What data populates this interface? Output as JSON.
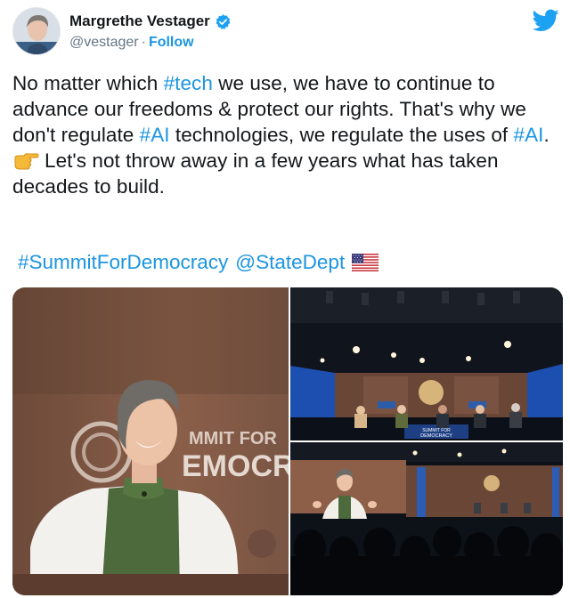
{
  "user": {
    "name": "Margrethe Vestager",
    "handle": "@vestager",
    "separator": "·",
    "follow_label": "Follow"
  },
  "icons": {
    "verified": "verified-badge-icon",
    "platform": "twitter-bird-icon",
    "hand": "backhand-index-pointing-right-icon",
    "flag": "us-flag-icon"
  },
  "colors": {
    "link": "#1b95e0",
    "verified": "#1da1f2",
    "text": "#14171a",
    "muted": "#657786"
  },
  "tweet": {
    "seg1": "No matter which ",
    "tag_tech": "#tech",
    "seg2": " we use, we have to continue to advance our freedoms & protect our rights. That's why we don't regulate ",
    "tag_ai1": "#AI",
    "seg3": " technologies, we regulate the uses of ",
    "tag_ai2": "#AI",
    "seg4": ".",
    "line2": "Let's not throw away in a few years what has taken decades to build.",
    "tag_summit": "#SummitForDemocracy",
    "mention": "@StateDept"
  },
  "photos": {
    "left": {
      "backdrop_text_1": "MMIT FOR",
      "backdrop_text_2": "EMOCR"
    },
    "top_right": {
      "stage_sign_1": "SUMMIT FOR",
      "stage_sign_2": "DEMOCRACY"
    }
  }
}
